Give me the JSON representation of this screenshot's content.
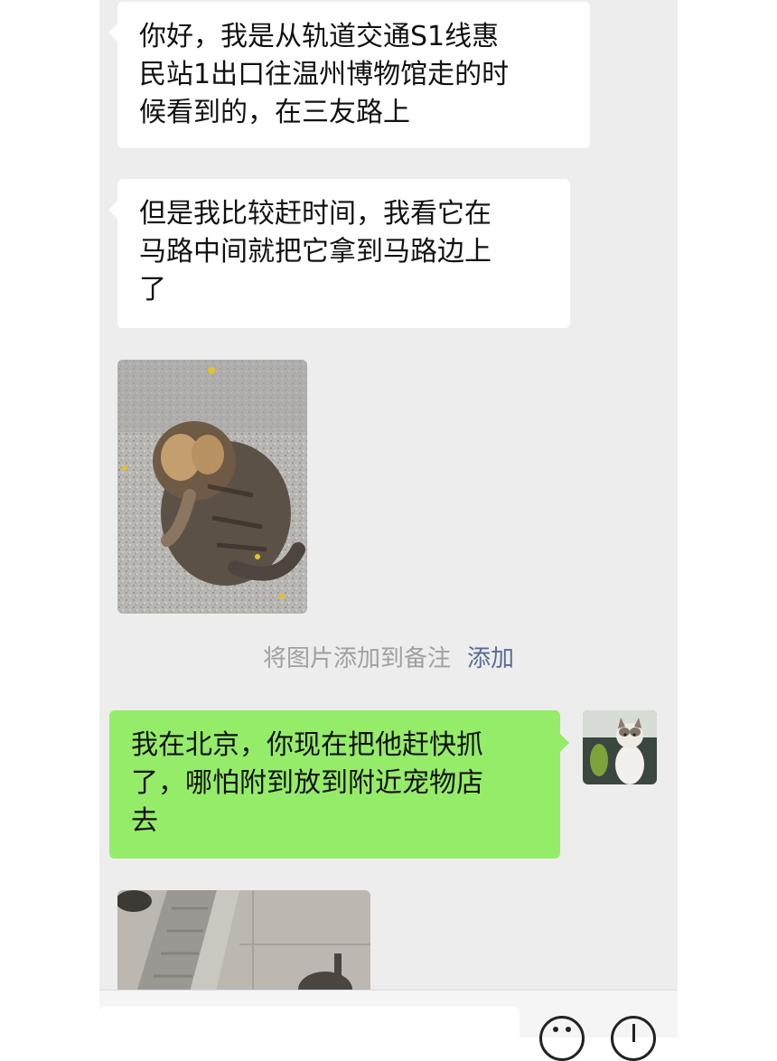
{
  "messages": {
    "m1_lines": [
      "你好，我是从轨道交通S1线惠",
      "民站1出口往温州博物馆走的时",
      "候看到的，在三友路上"
    ],
    "m2_lines": [
      "但是我比较赶时间，我看它在",
      "马路中间就把它拿到马路边上",
      "了"
    ],
    "m3_lines": [
      "我在北京，你现在把他赶快抓",
      "了，哪怕附到放到附近宠物店",
      "去"
    ]
  },
  "notice": {
    "text": "将图片添加到备注",
    "link": "添加"
  },
  "colors": {
    "chat_bg": "#ededed",
    "bubble_incoming": "#ffffff",
    "bubble_outgoing": "#95ec69",
    "link": "#576b95",
    "notice_text": "#a0a0a0"
  },
  "icons": [
    "emoji-icon",
    "plus-icon"
  ]
}
